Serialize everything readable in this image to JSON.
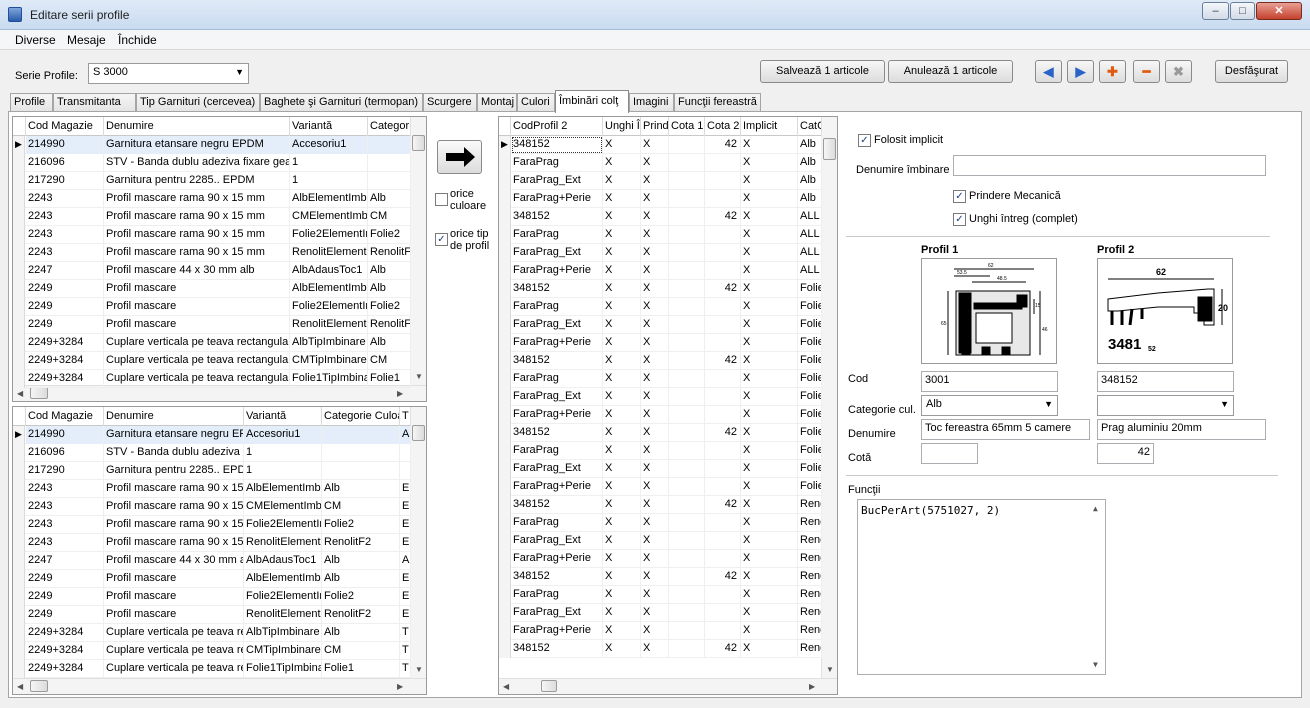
{
  "window": {
    "title": "Editare serii profile"
  },
  "menu": [
    "Diverse",
    "Mesaje",
    "Închide"
  ],
  "toolbar": {
    "serie_label": "Serie Profile:",
    "serie_value": "S 3000",
    "save": "Salvează 1 articole",
    "cancel": "Anulează 1 articole",
    "expand": "Desfăşurat",
    "nav_icons": [
      "arrow-left-icon",
      "arrow-right-icon",
      "add-icon",
      "remove-icon",
      "delete-icon"
    ]
  },
  "tabs": [
    "Profile",
    "Transmitanta",
    "Tip Garnituri (cercevea)",
    "Baghete şi Garnituri (termopan)",
    "Scurgere",
    "Montaj",
    "Culori",
    "Îmbinări colţ",
    "Imagini",
    "Funcţii fereastră"
  ],
  "grid_top": {
    "headers": [
      "Cod Magazie",
      "Denumire",
      "Variantă",
      "Categor"
    ],
    "rows": [
      [
        "214990",
        "Garnitura etansare negru EPDM",
        "Accesoriu1",
        ""
      ],
      [
        "216096",
        "STV - Banda dublu adeziva fixare geam",
        "1",
        ""
      ],
      [
        "217290",
        "Garnitura pentru 2285.. EPDM",
        "1",
        ""
      ],
      [
        "2243",
        "Profil mascare rama 90 x 15 mm",
        "AlbElementImbi",
        "Alb"
      ],
      [
        "2243",
        "Profil mascare rama 90 x 15 mm",
        "CMElementImbi",
        "CM"
      ],
      [
        "2243",
        "Profil mascare rama 90 x 15 mm",
        "Folie2ElementIn",
        "Folie2"
      ],
      [
        "2243",
        "Profil mascare rama 90 x 15 mm",
        "RenolitElementI",
        "RenolitF"
      ],
      [
        "2247",
        "Profil mascare 44 x 30 mm alb",
        "AlbAdausToc1",
        "Alb"
      ],
      [
        "2249",
        "Profil mascare",
        "AlbElementImbi",
        "Alb"
      ],
      [
        "2249",
        "Profil mascare",
        "Folie2ElementIn",
        "Folie2"
      ],
      [
        "2249",
        "Profil mascare",
        "RenolitElementI",
        "RenolitF"
      ],
      [
        "2249+3284",
        "Cuplare verticala pe teava rectangular",
        "AlbTipImbinare",
        "Alb"
      ],
      [
        "2249+3284",
        "Cuplare verticala pe teava rectangular",
        "CMTipImbinare",
        "CM"
      ],
      [
        "2249+3284",
        "Cuplare verticala pe teava rectangular",
        "Folie1TipImbina",
        "Folie1"
      ]
    ]
  },
  "grid_bottom": {
    "headers": [
      "Cod Magazie",
      "Denumire",
      "Variantă",
      "Categorie Culoa",
      "T"
    ],
    "rows": [
      [
        "214990",
        "Garnitura etansare negru EP",
        "Accesoriu1",
        "",
        "A"
      ],
      [
        "216096",
        "STV - Banda dublu adeziva fi",
        "1",
        "",
        ""
      ],
      [
        "217290",
        "Garnitura pentru 2285.. EPD",
        "1",
        "",
        ""
      ],
      [
        "2243",
        "Profil mascare rama 90 x 15",
        "AlbElementImbi",
        "Alb",
        "E"
      ],
      [
        "2243",
        "Profil mascare rama 90 x 15",
        "CMElementImbi",
        "CM",
        "E"
      ],
      [
        "2243",
        "Profil mascare rama 90 x 15",
        "Folie2ElementIn",
        "Folie2",
        "E"
      ],
      [
        "2243",
        "Profil mascare rama 90 x 15",
        "RenolitElementI",
        "RenolitF2",
        "E"
      ],
      [
        "2247",
        "Profil mascare 44 x 30 mm al",
        "AlbAdausToc1",
        "Alb",
        "A"
      ],
      [
        "2249",
        "Profil mascare",
        "AlbElementImbi",
        "Alb",
        "E"
      ],
      [
        "2249",
        "Profil mascare",
        "Folie2ElementIn",
        "Folie2",
        "E"
      ],
      [
        "2249",
        "Profil mascare",
        "RenolitElementI",
        "RenolitF2",
        "E"
      ],
      [
        "2249+3284",
        "Cuplare verticala pe teava re",
        "AlbTipImbinare",
        "Alb",
        "T"
      ],
      [
        "2249+3284",
        "Cuplare verticala pe teava re",
        "CMTipImbinare",
        "CM",
        "T"
      ],
      [
        "2249+3284",
        "Cuplare verticala pe teava re",
        "Folie1TipImbina",
        "Folie1",
        "T"
      ]
    ]
  },
  "middle": {
    "orice_culoare": "orice culoare",
    "orice_tip": "orice tip de profil"
  },
  "grid_joins": {
    "headers": [
      "CodProfil 2",
      "Unghi Î",
      "Prind",
      "Cota 1",
      "Cota 2",
      "Implicit",
      "CatC"
    ],
    "rows": [
      [
        "348152",
        "X",
        "X",
        "",
        "42",
        "X",
        "Alb"
      ],
      [
        "FaraPrag",
        "X",
        "X",
        "",
        "",
        "X",
        "Alb"
      ],
      [
        "FaraPrag_Ext",
        "X",
        "X",
        "",
        "",
        "X",
        "Alb"
      ],
      [
        "FaraPrag+Perie",
        "X",
        "X",
        "",
        "",
        "X",
        "Alb"
      ],
      [
        "348152",
        "X",
        "X",
        "",
        "42",
        "X",
        "ALL"
      ],
      [
        "FaraPrag",
        "X",
        "X",
        "",
        "",
        "X",
        "ALL"
      ],
      [
        "FaraPrag_Ext",
        "X",
        "X",
        "",
        "",
        "X",
        "ALL"
      ],
      [
        "FaraPrag+Perie",
        "X",
        "X",
        "",
        "",
        "X",
        "ALL"
      ],
      [
        "348152",
        "X",
        "X",
        "",
        "42",
        "X",
        "Folie"
      ],
      [
        "FaraPrag",
        "X",
        "X",
        "",
        "",
        "X",
        "Folie"
      ],
      [
        "FaraPrag_Ext",
        "X",
        "X",
        "",
        "",
        "X",
        "Folie"
      ],
      [
        "FaraPrag+Perie",
        "X",
        "X",
        "",
        "",
        "X",
        "Folie"
      ],
      [
        "348152",
        "X",
        "X",
        "",
        "42",
        "X",
        "Folie"
      ],
      [
        "FaraPrag",
        "X",
        "X",
        "",
        "",
        "X",
        "Folie"
      ],
      [
        "FaraPrag_Ext",
        "X",
        "X",
        "",
        "",
        "X",
        "Folie"
      ],
      [
        "FaraPrag+Perie",
        "X",
        "X",
        "",
        "",
        "X",
        "Folie"
      ],
      [
        "348152",
        "X",
        "X",
        "",
        "42",
        "X",
        "Folie"
      ],
      [
        "FaraPrag",
        "X",
        "X",
        "",
        "",
        "X",
        "Folie"
      ],
      [
        "FaraPrag_Ext",
        "X",
        "X",
        "",
        "",
        "X",
        "Folie"
      ],
      [
        "FaraPrag+Perie",
        "X",
        "X",
        "",
        "",
        "X",
        "Folie"
      ],
      [
        "348152",
        "X",
        "X",
        "",
        "42",
        "X",
        "Renc"
      ],
      [
        "FaraPrag",
        "X",
        "X",
        "",
        "",
        "X",
        "Renc"
      ],
      [
        "FaraPrag_Ext",
        "X",
        "X",
        "",
        "",
        "X",
        "Renc"
      ],
      [
        "FaraPrag+Perie",
        "X",
        "X",
        "",
        "",
        "X",
        "Renc"
      ],
      [
        "348152",
        "X",
        "X",
        "",
        "42",
        "X",
        "Renc"
      ],
      [
        "FaraPrag",
        "X",
        "X",
        "",
        "",
        "X",
        "Renc"
      ],
      [
        "FaraPrag_Ext",
        "X",
        "X",
        "",
        "",
        "X",
        "Renc"
      ],
      [
        "FaraPrag+Perie",
        "X",
        "X",
        "",
        "",
        "X",
        "Renc"
      ],
      [
        "348152",
        "X",
        "X",
        "",
        "42",
        "X",
        "Renc"
      ]
    ]
  },
  "details": {
    "folosit_implicit": "Folosit implicit",
    "denumire_imbinare_label": "Denumire îmbinare",
    "denumire_imbinare_value": "",
    "prindere": "Prindere Mecanică",
    "unghi": "Unghi întreg (complet)",
    "profil1_label": "Profil 1",
    "profil2_label": "Profil 2",
    "cod_label": "Cod",
    "cod1": "3001",
    "cod2": "348152",
    "categorie_label": "Categorie cul.",
    "categorie1": "Alb",
    "categorie2": "",
    "denumire_label": "Denumire",
    "denumire1": "Toc fereastra 65mm 5 camere",
    "denumire2": "Prag aluminiu 20mm",
    "cota_label": "Cotă",
    "cota1": "",
    "cota2": "42",
    "functii_label": "Funcţii",
    "functii_value": "BucPerArt(5751027, 2)",
    "img1_dims": [
      "62",
      "53.5",
      "48.5",
      "65",
      "46",
      "15"
    ],
    "img2_dims": [
      "62",
      "20",
      "3481",
      "52"
    ]
  }
}
